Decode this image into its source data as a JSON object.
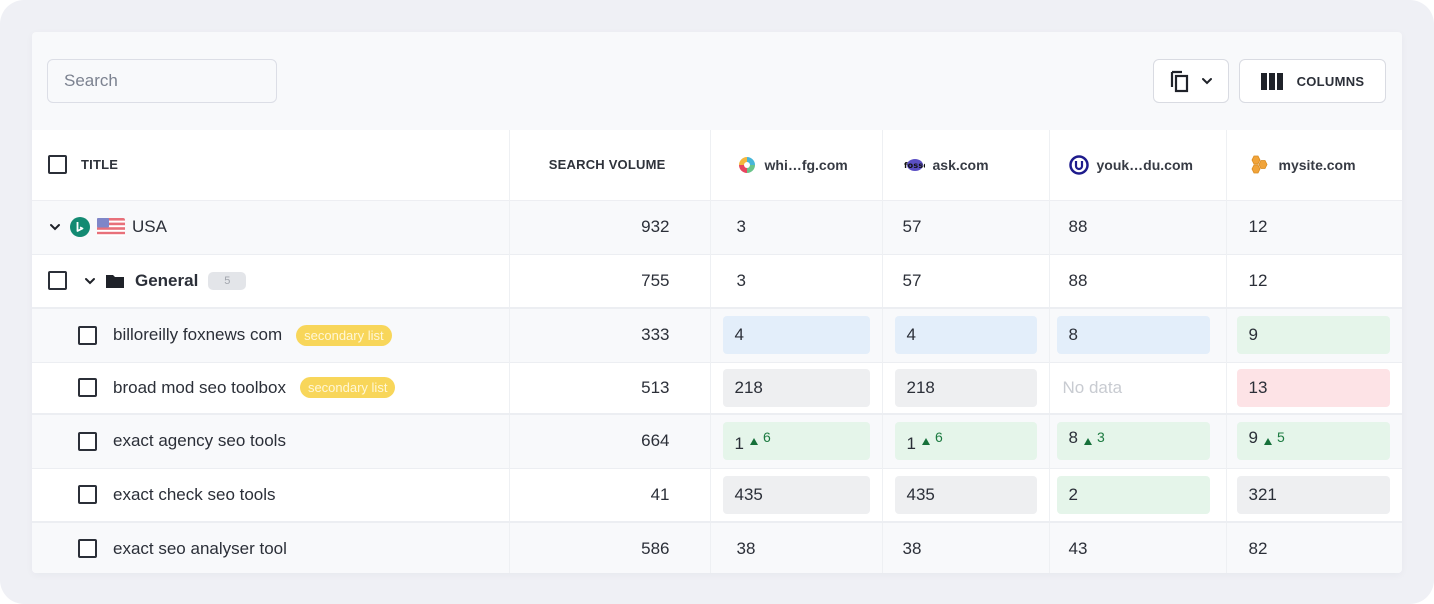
{
  "toolbar": {
    "search_placeholder": "Search",
    "search_value": "",
    "copy_button_icon": "copy-icon",
    "copy_dropdown_icon": "chevron-down-icon",
    "columns_label": "COLUMNS",
    "columns_icon": "columns-icon"
  },
  "table": {
    "headers": {
      "title": "TITLE",
      "search_volume": "SEARCH VOLUME",
      "sites": [
        {
          "name": "whi…fg.com",
          "icon": "whifg-logo-icon"
        },
        {
          "name": "ask.com",
          "icon": "fosso-logo-icon"
        },
        {
          "name": "youk…du.com",
          "icon": "u-circle-logo-icon"
        },
        {
          "name": "mysite.com",
          "icon": "honeycomb-logo-icon"
        }
      ]
    },
    "region_row": {
      "label": "USA",
      "engine_icon": "bing-icon",
      "flag_icon": "us-flag-icon",
      "search_volume": "932",
      "values": [
        "3",
        "57",
        "88",
        "12"
      ]
    },
    "group_row": {
      "label": "General",
      "count": "5",
      "search_volume": "755",
      "values": [
        "3",
        "57",
        "88",
        "12"
      ]
    },
    "keywords": [
      {
        "title": "billoreilly foxnews com",
        "tag": "secondary list",
        "search_volume": "333",
        "cells": [
          {
            "value": "4",
            "status": "blue"
          },
          {
            "value": "4",
            "status": "blue"
          },
          {
            "value": "8",
            "status": "blue"
          },
          {
            "value": "9",
            "status": "green"
          }
        ]
      },
      {
        "title": "broad mod seo toolbox",
        "tag": "secondary list",
        "search_volume": "513",
        "cells": [
          {
            "value": "218",
            "status": "gray"
          },
          {
            "value": "218",
            "status": "gray"
          },
          {
            "value": "No data",
            "status": "none"
          },
          {
            "value": "13",
            "status": "red"
          }
        ]
      },
      {
        "title": "exact agency seo tools",
        "tag": "",
        "search_volume": "664",
        "cells": [
          {
            "value": "1",
            "delta": "6",
            "status": "green"
          },
          {
            "value": "1",
            "delta": "6",
            "status": "green"
          },
          {
            "value": "8",
            "delta": "3",
            "status": "green"
          },
          {
            "value": "9",
            "delta": "5",
            "status": "green"
          }
        ]
      },
      {
        "title": "exact check seo tools",
        "tag": "",
        "search_volume": "41",
        "cells": [
          {
            "value": "435",
            "status": "gray"
          },
          {
            "value": "435",
            "status": "gray"
          },
          {
            "value": "2",
            "status": "green"
          },
          {
            "value": "321",
            "status": "gray"
          }
        ]
      },
      {
        "title": "exact seo analyser tool",
        "tag": "",
        "search_volume": "586",
        "cells": [
          {
            "value": "38",
            "status": "plain"
          },
          {
            "value": "38",
            "status": "plain"
          },
          {
            "value": "43",
            "status": "plain"
          },
          {
            "value": "82",
            "status": "plain"
          }
        ]
      }
    ]
  },
  "colors": {
    "blue_cell": "#e3eefa",
    "gray_cell": "#eeeff1",
    "green_cell": "#e5f5ea",
    "red_cell": "#fde3e6",
    "tag_yellow": "#f8d65a",
    "delta_green": "#16703a",
    "bing_green": "#138a72"
  }
}
